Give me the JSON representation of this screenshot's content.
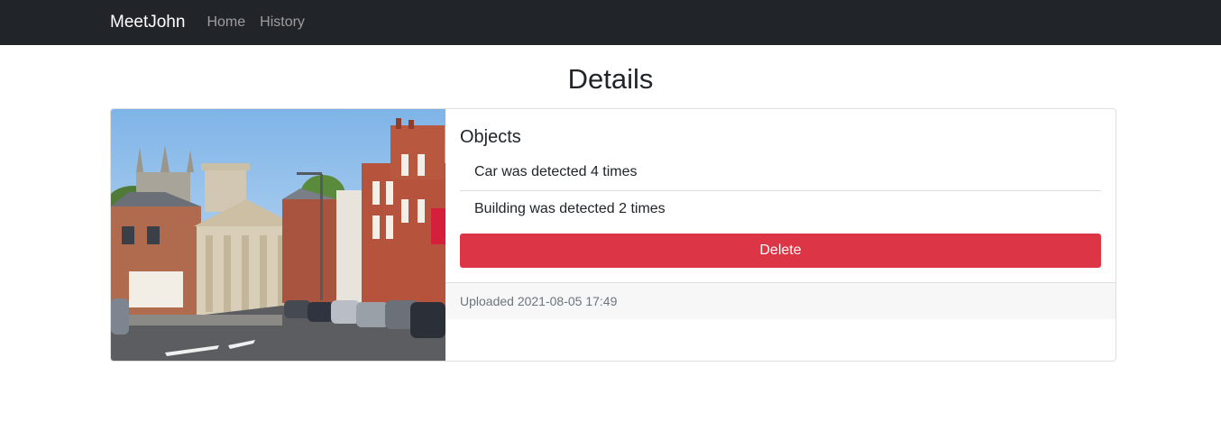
{
  "navbar": {
    "brand": "MeetJohn",
    "links": [
      "Home",
      "History"
    ]
  },
  "page": {
    "title": "Details"
  },
  "card": {
    "heading": "Objects",
    "objects": [
      "Car was detected 4 times",
      "Building was detected 2 times"
    ],
    "delete_label": "Delete",
    "uploaded": "Uploaded 2021-08-05 17:49"
  },
  "colors": {
    "navbar_bg": "#212529",
    "danger": "#dc3545",
    "footer_bg": "#f7f7f7"
  }
}
